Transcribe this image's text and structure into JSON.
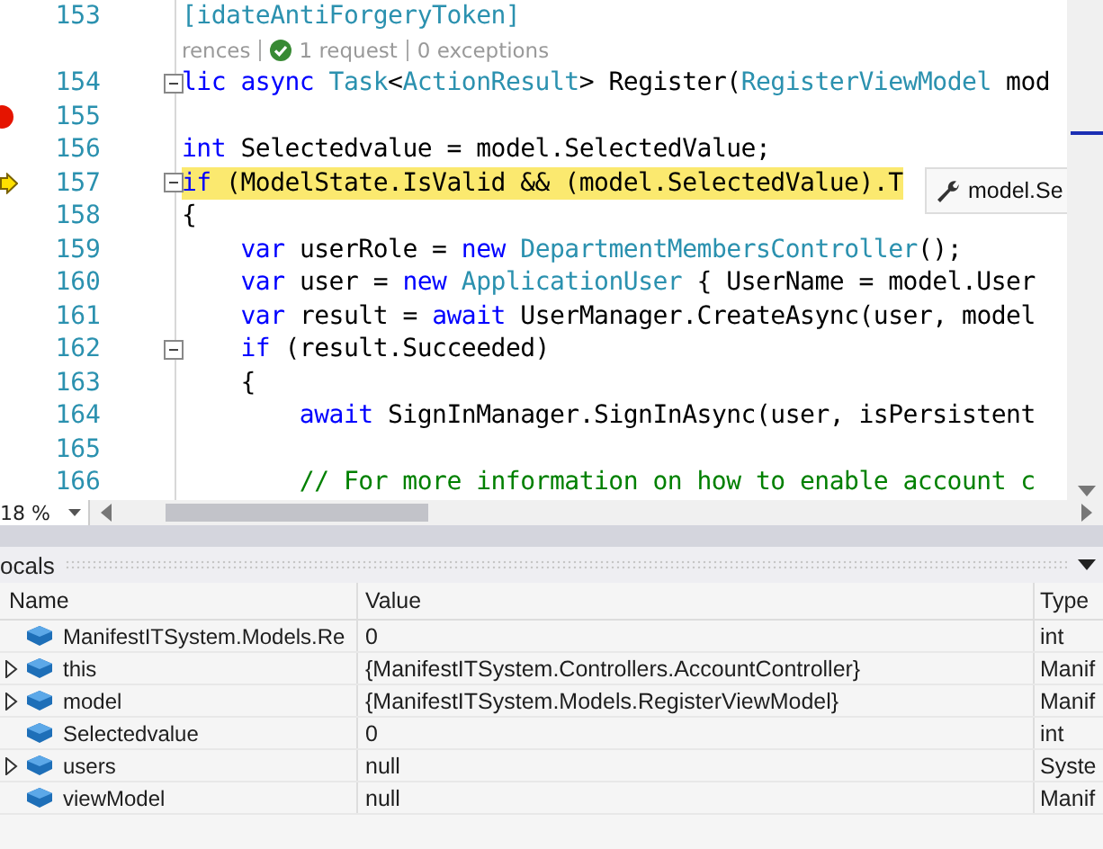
{
  "editor": {
    "lines": [
      {
        "kind": "code",
        "number": "153",
        "breakpoint": false,
        "current": false,
        "collapsible": false,
        "highlighted": false,
        "tokens": [
          {
            "kind": "type",
            "text": "[idateAntiForgeryToken]"
          }
        ]
      },
      {
        "kind": "codelens",
        "parts": [
          {
            "text": "rences",
            "check": false
          },
          {
            "text": "1 request",
            "check": true
          },
          {
            "text": "0 exceptions",
            "check": false
          }
        ]
      },
      {
        "kind": "code",
        "number": "154",
        "breakpoint": false,
        "current": false,
        "collapsible": true,
        "highlighted": false,
        "tokens": [
          {
            "kind": "keyword",
            "text": "lic async "
          },
          {
            "kind": "type",
            "text": "Task"
          },
          {
            "kind": "plain",
            "text": "<"
          },
          {
            "kind": "type",
            "text": "ActionResult"
          },
          {
            "kind": "plain",
            "text": "> Register("
          },
          {
            "kind": "type",
            "text": "RegisterViewModel"
          },
          {
            "kind": "plain",
            "text": " mod"
          }
        ]
      },
      {
        "kind": "code",
        "number": "155",
        "breakpoint": true,
        "current": false,
        "collapsible": false
      },
      {
        "kind": "code",
        "number": "156",
        "breakpoint": false,
        "current": false,
        "collapsible": false,
        "highlighted": false,
        "tokens": [
          {
            "kind": "keyword",
            "text": "int"
          },
          {
            "kind": "plain",
            "text": " Selectedvalue = model.SelectedValue;"
          }
        ]
      },
      {
        "kind": "code",
        "number": "157",
        "breakpoint": false,
        "current": true,
        "collapsible": true,
        "highlighted": true,
        "tokens": [
          {
            "kind": "keyword",
            "text": "if"
          },
          {
            "kind": "plain",
            "text": " (ModelState.IsValid && (model.SelectedValue).T"
          }
        ]
      },
      {
        "kind": "code",
        "number": "158",
        "breakpoint": false,
        "current": false,
        "collapsible": false,
        "highlighted": false,
        "tokens": [
          {
            "kind": "plain",
            "text": "{"
          }
        ]
      },
      {
        "kind": "code",
        "number": "159",
        "breakpoint": false,
        "current": false,
        "collapsible": false,
        "highlighted": false,
        "tokens": [
          {
            "kind": "keyword",
            "text": "    var"
          },
          {
            "kind": "plain",
            "text": " userRole = "
          },
          {
            "kind": "keyword",
            "text": "new"
          },
          {
            "kind": "type",
            "text": " DepartmentMembersController"
          },
          {
            "kind": "plain",
            "text": "();"
          }
        ]
      },
      {
        "kind": "code",
        "number": "160",
        "breakpoint": false,
        "current": false,
        "collapsible": false,
        "highlighted": false,
        "tokens": [
          {
            "kind": "keyword",
            "text": "    var"
          },
          {
            "kind": "plain",
            "text": " user = "
          },
          {
            "kind": "keyword",
            "text": "new"
          },
          {
            "kind": "type",
            "text": " ApplicationUser"
          },
          {
            "kind": "plain",
            "text": " { UserName = model.User"
          }
        ]
      },
      {
        "kind": "code",
        "number": "161",
        "breakpoint": false,
        "current": false,
        "collapsible": false,
        "highlighted": false,
        "tokens": [
          {
            "kind": "keyword",
            "text": "    var"
          },
          {
            "kind": "plain",
            "text": " result = "
          },
          {
            "kind": "keyword",
            "text": "await"
          },
          {
            "kind": "plain",
            "text": " UserManager.CreateAsync(user, model"
          }
        ]
      },
      {
        "kind": "code",
        "number": "162",
        "breakpoint": false,
        "current": false,
        "collapsible": true,
        "highlighted": false,
        "tokens": [
          {
            "kind": "keyword",
            "text": "    if"
          },
          {
            "kind": "plain",
            "text": " (result.Succeeded)"
          }
        ]
      },
      {
        "kind": "code",
        "number": "163",
        "breakpoint": false,
        "current": false,
        "collapsible": false,
        "highlighted": false,
        "tokens": [
          {
            "kind": "plain",
            "text": "    {"
          }
        ]
      },
      {
        "kind": "code",
        "number": "164",
        "breakpoint": false,
        "current": false,
        "collapsible": false,
        "highlighted": false,
        "tokens": [
          {
            "kind": "keyword",
            "text": "        await"
          },
          {
            "kind": "plain",
            "text": " SignInManager.SignInAsync(user, isPersistent"
          }
        ]
      },
      {
        "kind": "code",
        "number": "165",
        "breakpoint": false,
        "current": false,
        "collapsible": false
      },
      {
        "kind": "code",
        "number": "166",
        "breakpoint": false,
        "current": false,
        "collapsible": false,
        "highlighted": false,
        "tokens": [
          {
            "kind": "comment",
            "text": "        // For more information on how to enable account c"
          }
        ]
      }
    ],
    "tooltip": {
      "text": "model.Se"
    },
    "zoom": "18 %"
  },
  "locals": {
    "title": "ocals",
    "columns": [
      "Name",
      "Value",
      "Type"
    ],
    "rows": [
      {
        "name": "ManifestITSystem.Models.Re",
        "value": "0",
        "type": "int",
        "expandable": false
      },
      {
        "name": "this",
        "value": "{ManifestITSystem.Controllers.AccountController}",
        "type": "Manif",
        "expandable": true
      },
      {
        "name": "model",
        "value": "{ManifestITSystem.Models.RegisterViewModel}",
        "type": "Manif",
        "expandable": true
      },
      {
        "name": "Selectedvalue",
        "value": "0",
        "type": "int",
        "expandable": false
      },
      {
        "name": "users",
        "value": "null",
        "type": "Syste",
        "expandable": true
      },
      {
        "name": "viewModel",
        "value": "null",
        "type": "Manif",
        "expandable": false
      }
    ]
  }
}
